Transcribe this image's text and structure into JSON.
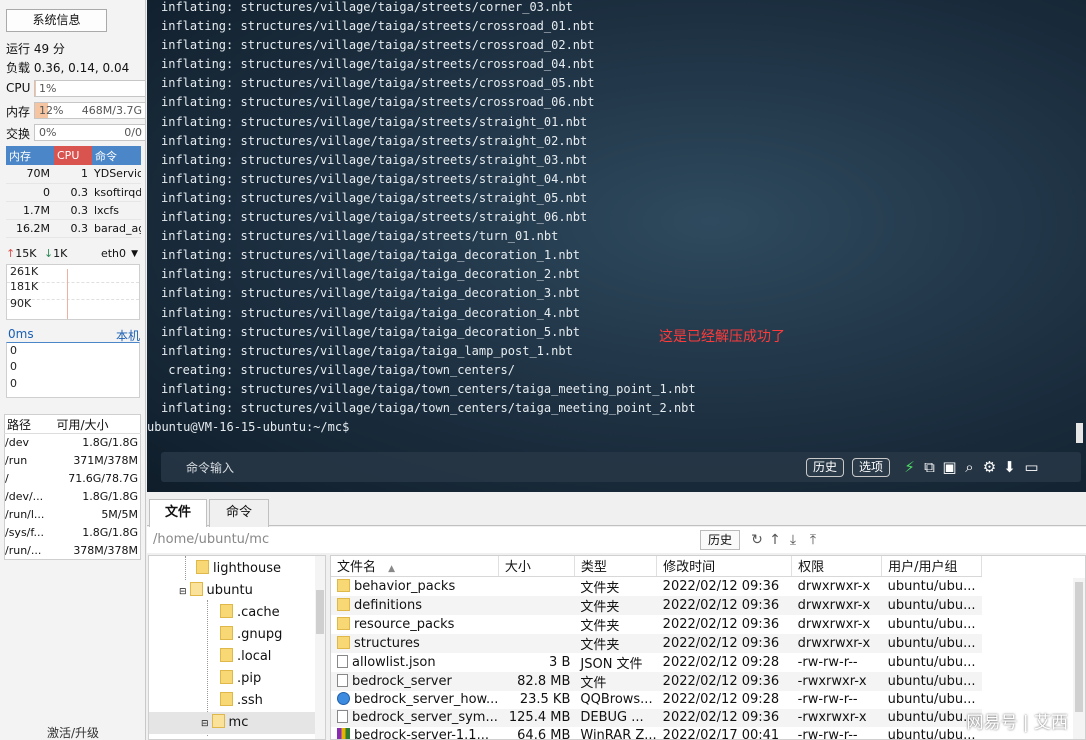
{
  "sidebar": {
    "sysinfo_button": "系统信息",
    "uptime": "运行 49 分",
    "load": "负载 0.36, 0.14, 0.04",
    "cpu": {
      "label": "CPU",
      "value": "1%",
      "fraction": 0.01
    },
    "mem": {
      "label": "内存",
      "value": "12%",
      "detail": "468M/3.7G",
      "fraction": 0.12
    },
    "swap": {
      "label": "交换",
      "value": "0%",
      "detail": "0/0",
      "fraction": 0
    },
    "proc_headers": [
      "内存",
      "CPU",
      "命令"
    ],
    "processes": [
      {
        "mem": "70M",
        "cpu": "1",
        "cmd": "YDService"
      },
      {
        "mem": "0",
        "cpu": "0.3",
        "cmd": "ksoftirqd"
      },
      {
        "mem": "1.7M",
        "cpu": "0.3",
        "cmd": "lxcfs"
      },
      {
        "mem": "16.2M",
        "cpu": "0.3",
        "cmd": "barad_agent"
      }
    ],
    "net": {
      "up": "15K",
      "down": "1K",
      "iface": "eth0",
      "levels": [
        "261K",
        "181K",
        "90K"
      ]
    },
    "latency": {
      "value": "0ms",
      "host": "本机",
      "levels": [
        "0",
        "0",
        "0"
      ]
    },
    "disk_headers": [
      "路径",
      "可用/大小"
    ],
    "disks": [
      {
        "path": "/dev",
        "size": "1.8G/1.8G"
      },
      {
        "path": "/run",
        "size": "371M/378M"
      },
      {
        "path": "/",
        "size": "71.6G/78.7G"
      },
      {
        "path": "/dev/...",
        "size": "1.8G/1.8G"
      },
      {
        "path": "/run/l...",
        "size": "5M/5M"
      },
      {
        "path": "/sys/f...",
        "size": "1.8G/1.8G"
      },
      {
        "path": "/run/...",
        "size": "378M/378M"
      }
    ],
    "footer": "激活/升级"
  },
  "terminal": {
    "lines": [
      "inflating: structures/village/taiga/streets/corner_03.nbt",
      "inflating: structures/village/taiga/streets/crossroad_01.nbt",
      "inflating: structures/village/taiga/streets/crossroad_02.nbt",
      "inflating: structures/village/taiga/streets/crossroad_04.nbt",
      "inflating: structures/village/taiga/streets/crossroad_05.nbt",
      "inflating: structures/village/taiga/streets/crossroad_06.nbt",
      "inflating: structures/village/taiga/streets/straight_01.nbt",
      "inflating: structures/village/taiga/streets/straight_02.nbt",
      "inflating: structures/village/taiga/streets/straight_03.nbt",
      "inflating: structures/village/taiga/streets/straight_04.nbt",
      "inflating: structures/village/taiga/streets/straight_05.nbt",
      "inflating: structures/village/taiga/streets/straight_06.nbt",
      "inflating: structures/village/taiga/streets/turn_01.nbt",
      "inflating: structures/village/taiga/taiga_decoration_1.nbt",
      "inflating: structures/village/taiga/taiga_decoration_2.nbt",
      "inflating: structures/village/taiga/taiga_decoration_3.nbt",
      "inflating: structures/village/taiga/taiga_decoration_4.nbt",
      "inflating: structures/village/taiga/taiga_decoration_5.nbt",
      "inflating: structures/village/taiga/taiga_lamp_post_1.nbt",
      " creating: structures/village/taiga/town_centers/",
      "inflating: structures/village/taiga/town_centers/taiga_meeting_point_1.nbt",
      "inflating: structures/village/taiga/town_centers/taiga_meeting_point_2.nbt"
    ],
    "prompt": "ubuntu@VM-16-15-ubuntu:~/mc$",
    "annotation": "这是已经解压成功了",
    "command_placeholder": "命令输入",
    "history_button": "历史",
    "options_button": "选项"
  },
  "tabs": [
    "文件",
    "命令"
  ],
  "filebrowser": {
    "path": "/home/ubuntu/mc",
    "history_button": "历史",
    "tree": [
      "lighthouse",
      "ubuntu",
      ".cache",
      ".gnupg",
      ".local",
      ".pip",
      ".ssh",
      "mc"
    ],
    "columns": [
      "文件名",
      "大小",
      "类型",
      "修改时间",
      "权限",
      "用户/用户组"
    ],
    "files": [
      {
        "name": "behavior_packs",
        "size": "",
        "type": "文件夹",
        "mtime": "2022/02/12 09:36",
        "perm": "drwxrwxr-x",
        "owner": "ubuntu/ubu...",
        "icon": "folder-icon"
      },
      {
        "name": "definitions",
        "size": "",
        "type": "文件夹",
        "mtime": "2022/02/12 09:36",
        "perm": "drwxrwxr-x",
        "owner": "ubuntu/ubu...",
        "icon": "folder-icon"
      },
      {
        "name": "resource_packs",
        "size": "",
        "type": "文件夹",
        "mtime": "2022/02/12 09:36",
        "perm": "drwxrwxr-x",
        "owner": "ubuntu/ubu...",
        "icon": "folder-icon"
      },
      {
        "name": "structures",
        "size": "",
        "type": "文件夹",
        "mtime": "2022/02/12 09:36",
        "perm": "drwxrwxr-x",
        "owner": "ubuntu/ubu...",
        "icon": "folder-icon"
      },
      {
        "name": "allowlist.json",
        "size": "3 B",
        "type": "JSON 文件",
        "mtime": "2022/02/12 09:28",
        "perm": "-rw-rw-r--",
        "owner": "ubuntu/ubu...",
        "icon": "file-icon"
      },
      {
        "name": "bedrock_server",
        "size": "82.8 MB",
        "type": "文件",
        "mtime": "2022/02/12 09:36",
        "perm": "-rwxrwxr-x",
        "owner": "ubuntu/ubu...",
        "icon": "file-icon"
      },
      {
        "name": "bedrock_server_how...",
        "size": "23.5 KB",
        "type": "QQBrows...",
        "mtime": "2022/02/12 09:28",
        "perm": "-rw-rw-r--",
        "owner": "ubuntu/ubu...",
        "icon": "browser-icon"
      },
      {
        "name": "bedrock_server_sym...",
        "size": "125.4 MB",
        "type": "DEBUG ...",
        "mtime": "2022/02/12 09:36",
        "perm": "-rwxrwxr-x",
        "owner": "ubuntu/ubu...",
        "icon": "file-icon"
      },
      {
        "name": "bedrock-server-1.1...",
        "size": "64.6 MB",
        "type": "WinRAR Z...",
        "mtime": "2022/02/17 00:41",
        "perm": "-rw-rw-r--",
        "owner": "ubuntu/ubu...",
        "icon": "archive-icon"
      }
    ]
  },
  "watermark": "网易号 | 艾西"
}
